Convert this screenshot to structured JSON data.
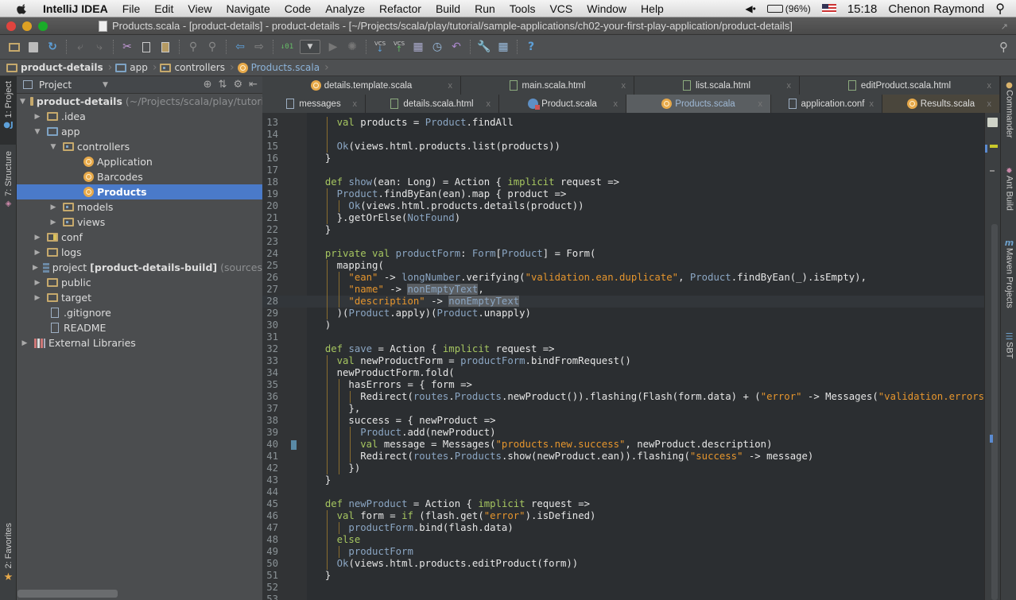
{
  "menubar": {
    "app_name": "IntelliJ IDEA",
    "items": [
      "File",
      "Edit",
      "View",
      "Navigate",
      "Code",
      "Analyze",
      "Refactor",
      "Build",
      "Run",
      "Tools",
      "VCS",
      "Window",
      "Help"
    ],
    "battery": "(96%)",
    "time": "15:18",
    "user": "Chenon Raymond"
  },
  "window": {
    "title": "Products.scala - [product-details] - product-details - [~/Projects/scala/play/tutorial/sample-applications/ch02-your-first-play-application/product-details]"
  },
  "toolbar": {
    "buttons": [
      "open-icon",
      "save-icon",
      "sync-icon",
      "undo-icon",
      "redo-icon",
      "cut-icon",
      "copy-icon",
      "paste-icon",
      "find-icon",
      "replace-icon",
      "back-icon",
      "forward-icon",
      "make-icon",
      "run-config-dropdown",
      "run-icon",
      "debug-icon",
      "vcs-update-icon",
      "vcs-commit-icon",
      "vcs-compare-icon",
      "vcs-history-icon",
      "vcs-revert-icon",
      "settings-icon",
      "project-structure-icon",
      "help-icon"
    ],
    "vcs_label": "VCS"
  },
  "breadcrumb": [
    {
      "label": "product-details",
      "icon": "project-folder-icon"
    },
    {
      "label": "app",
      "icon": "folder-icon"
    },
    {
      "label": "controllers",
      "icon": "package-icon"
    },
    {
      "label": "Products.scala",
      "icon": "scala-object-icon"
    }
  ],
  "left_strip": {
    "project_tab": "1: Project",
    "structure_tab": "7: Structure",
    "favorites_tab": "2: Favorites"
  },
  "project_panel": {
    "view_selector": "Project",
    "tree": [
      {
        "label": "product-details",
        "suffix": "(~/Projects/scala/play/tutori",
        "level": 0,
        "expanded": true,
        "icon": "project-folder-icon",
        "bold": true
      },
      {
        "label": ".idea",
        "level": 1,
        "expanded": false,
        "icon": "folder-icon"
      },
      {
        "label": "app",
        "level": 1,
        "expanded": true,
        "icon": "source-folder-icon"
      },
      {
        "label": "controllers",
        "level": 2,
        "expanded": true,
        "icon": "package-icon"
      },
      {
        "label": "Application",
        "level": 3,
        "icon": "scala-object-icon"
      },
      {
        "label": "Barcodes",
        "level": 3,
        "icon": "scala-object-icon"
      },
      {
        "label": "Products",
        "level": 3,
        "icon": "scala-object-icon",
        "selected": true
      },
      {
        "label": "models",
        "level": 2,
        "expanded": false,
        "icon": "package-icon"
      },
      {
        "label": "views",
        "level": 2,
        "expanded": false,
        "icon": "package-icon"
      },
      {
        "label": "conf",
        "level": 1,
        "expanded": false,
        "icon": "resource-folder-icon"
      },
      {
        "label": "logs",
        "level": 1,
        "expanded": false,
        "icon": "folder-icon"
      },
      {
        "label": "project",
        "bold_part": "[product-details-build]",
        "suffix": "(sources",
        "level": 1,
        "expanded": false,
        "icon": "module-icon"
      },
      {
        "label": "public",
        "level": 1,
        "expanded": false,
        "icon": "folder-icon"
      },
      {
        "label": "target",
        "level": 1,
        "expanded": false,
        "icon": "folder-icon"
      },
      {
        "label": ".gitignore",
        "level": 1,
        "icon": "file-icon"
      },
      {
        "label": "README",
        "level": 1,
        "icon": "file-icon"
      },
      {
        "label": "External Libraries",
        "level": 0,
        "expanded": false,
        "icon": "library-icon"
      }
    ]
  },
  "tabs_row1": [
    {
      "label": "details.template.scala",
      "icon": "scala-object-icon"
    },
    {
      "label": "main.scala.html",
      "icon": "html-file-icon"
    },
    {
      "label": "list.scala.html",
      "icon": "html-file-icon"
    },
    {
      "label": "editProduct.scala.html",
      "icon": "html-file-icon"
    }
  ],
  "tabs_row2": [
    {
      "label": "messages",
      "icon": "text-file-icon"
    },
    {
      "label": "details.scala.html",
      "icon": "html-file-icon"
    },
    {
      "label": "Product.scala",
      "icon": "scala-class-icon"
    },
    {
      "label": "Products.scala",
      "icon": "scala-object-icon",
      "active": true
    },
    {
      "label": "application.conf",
      "icon": "config-file-icon"
    },
    {
      "label": "Results.scala",
      "icon": "scala-object-icon"
    }
  ],
  "right_strip": {
    "items": [
      "Commander",
      "Ant Build",
      "Maven Projects",
      "SBT"
    ]
  },
  "editor": {
    "file": "Products.scala",
    "caret_line": 28,
    "bookmark_line": 40,
    "lines": [
      {
        "n": "13",
        "indent": 4,
        "tokens": [
          [
            "kw",
            "val"
          ],
          [
            "txt",
            " products = "
          ],
          [
            "ty",
            "Product"
          ],
          [
            "txt",
            ".findAll"
          ]
        ]
      },
      {
        "n": "14",
        "indent": 0,
        "tokens": []
      },
      {
        "n": "15",
        "indent": 4,
        "tokens": [
          [
            "ty",
            "Ok"
          ],
          [
            "txt",
            "(views.html.products.list(products))"
          ]
        ]
      },
      {
        "n": "16",
        "indent": 2,
        "tokens": [
          [
            "txt",
            "}"
          ]
        ]
      },
      {
        "n": "17",
        "indent": 0,
        "tokens": []
      },
      {
        "n": "18",
        "indent": 2,
        "tokens": [
          [
            "kw",
            "def"
          ],
          [
            "txt",
            " "
          ],
          [
            "id",
            "show"
          ],
          [
            "txt",
            "(ean: Long) = Action { "
          ],
          [
            "kw",
            "implicit"
          ],
          [
            "txt",
            " request =>"
          ]
        ]
      },
      {
        "n": "19",
        "indent": 4,
        "tokens": [
          [
            "ty",
            "Product"
          ],
          [
            "txt",
            ".findByEan(ean).map { product =>"
          ]
        ]
      },
      {
        "n": "20",
        "indent": 6,
        "tokens": [
          [
            "ty",
            "Ok"
          ],
          [
            "txt",
            "(views.html.products.details(product))"
          ]
        ]
      },
      {
        "n": "21",
        "indent": 4,
        "tokens": [
          [
            "txt",
            "}.getOrElse("
          ],
          [
            "ty",
            "NotFound"
          ],
          [
            "txt",
            ")"
          ]
        ]
      },
      {
        "n": "22",
        "indent": 2,
        "tokens": [
          [
            "txt",
            "}"
          ]
        ]
      },
      {
        "n": "23",
        "indent": 0,
        "tokens": []
      },
      {
        "n": "24",
        "indent": 2,
        "tokens": [
          [
            "kw",
            "private val"
          ],
          [
            "txt",
            " "
          ],
          [
            "id",
            "productForm"
          ],
          [
            "txt",
            ": "
          ],
          [
            "ty",
            "Form"
          ],
          [
            "txt",
            "["
          ],
          [
            "ty",
            "Product"
          ],
          [
            "txt",
            "] = Form("
          ]
        ]
      },
      {
        "n": "25",
        "indent": 4,
        "tokens": [
          [
            "txt",
            "mapping("
          ]
        ]
      },
      {
        "n": "26",
        "indent": 6,
        "tokens": [
          [
            "str",
            "\"ean\""
          ],
          [
            "txt",
            " -> "
          ],
          [
            "id",
            "longNumber"
          ],
          [
            "txt",
            ".verifying("
          ],
          [
            "str",
            "\"validation.ean.duplicate\""
          ],
          [
            "txt",
            ", "
          ],
          [
            "ty",
            "Product"
          ],
          [
            "txt",
            ".findByEan(_).isEmpty),"
          ]
        ]
      },
      {
        "n": "27",
        "indent": 6,
        "tokens": [
          [
            "str",
            "\"name\""
          ],
          [
            "txt",
            " -> "
          ],
          [
            "hl",
            "nonEmptyText"
          ],
          [
            "txt",
            ","
          ]
        ]
      },
      {
        "n": "28",
        "indent": 6,
        "tokens": [
          [
            "str",
            "\"description\""
          ],
          [
            "txt",
            " -> "
          ],
          [
            "hl",
            "nonEmptyText"
          ]
        ]
      },
      {
        "n": "29",
        "indent": 4,
        "tokens": [
          [
            "txt",
            ")("
          ],
          [
            "ty",
            "Product"
          ],
          [
            "txt",
            ".apply)("
          ],
          [
            "ty",
            "Product"
          ],
          [
            "txt",
            ".unapply)"
          ]
        ]
      },
      {
        "n": "30",
        "indent": 2,
        "tokens": [
          [
            "txt",
            ")"
          ]
        ]
      },
      {
        "n": "31",
        "indent": 0,
        "tokens": []
      },
      {
        "n": "32",
        "indent": 2,
        "tokens": [
          [
            "kw",
            "def"
          ],
          [
            "txt",
            " "
          ],
          [
            "id",
            "save"
          ],
          [
            "txt",
            " = Action { "
          ],
          [
            "kw",
            "implicit"
          ],
          [
            "txt",
            " request =>"
          ]
        ]
      },
      {
        "n": "33",
        "indent": 4,
        "tokens": [
          [
            "kw",
            "val"
          ],
          [
            "txt",
            " newProductForm = "
          ],
          [
            "id",
            "productForm"
          ],
          [
            "txt",
            ".bindFromRequest()"
          ]
        ]
      },
      {
        "n": "34",
        "indent": 4,
        "tokens": [
          [
            "txt",
            "newProductForm.fold("
          ]
        ]
      },
      {
        "n": "35",
        "indent": 6,
        "tokens": [
          [
            "txt",
            "hasErrors = { form =>"
          ]
        ]
      },
      {
        "n": "36",
        "indent": 8,
        "tokens": [
          [
            "txt",
            "Redirect("
          ],
          [
            "id",
            "routes"
          ],
          [
            "txt",
            "."
          ],
          [
            "ty",
            "Products"
          ],
          [
            "txt",
            ".newProduct()).flashing(Flash(form.data) + ("
          ],
          [
            "str",
            "\"error\""
          ],
          [
            "txt",
            " -> Messages("
          ],
          [
            "str",
            "\"validation.errors\""
          ],
          [
            "txt",
            ")))"
          ]
        ]
      },
      {
        "n": "37",
        "indent": 6,
        "tokens": [
          [
            "txt",
            "},"
          ]
        ]
      },
      {
        "n": "38",
        "indent": 6,
        "tokens": [
          [
            "txt",
            "success = { newProduct =>"
          ]
        ]
      },
      {
        "n": "39",
        "indent": 8,
        "tokens": [
          [
            "ty",
            "Product"
          ],
          [
            "txt",
            ".add(newProduct)"
          ]
        ]
      },
      {
        "n": "40",
        "indent": 8,
        "tokens": [
          [
            "kw",
            "val"
          ],
          [
            "txt",
            " message = Messages("
          ],
          [
            "str",
            "\"products.new.success\""
          ],
          [
            "txt",
            ", newProduct.description)"
          ]
        ]
      },
      {
        "n": "41",
        "indent": 8,
        "tokens": [
          [
            "txt",
            "Redirect("
          ],
          [
            "id",
            "routes"
          ],
          [
            "txt",
            "."
          ],
          [
            "ty",
            "Products"
          ],
          [
            "txt",
            ".show(newProduct.ean)).flashing("
          ],
          [
            "str",
            "\"success\""
          ],
          [
            "txt",
            " -> message)"
          ]
        ]
      },
      {
        "n": "42",
        "indent": 6,
        "tokens": [
          [
            "txt",
            "})"
          ]
        ]
      },
      {
        "n": "43",
        "indent": 2,
        "tokens": [
          [
            "txt",
            "}"
          ]
        ]
      },
      {
        "n": "44",
        "indent": 0,
        "tokens": []
      },
      {
        "n": "45",
        "indent": 2,
        "tokens": [
          [
            "kw",
            "def"
          ],
          [
            "txt",
            " "
          ],
          [
            "id",
            "newProduct"
          ],
          [
            "txt",
            " = Action { "
          ],
          [
            "kw",
            "implicit"
          ],
          [
            "txt",
            " request =>"
          ]
        ]
      },
      {
        "n": "46",
        "indent": 4,
        "tokens": [
          [
            "kw",
            "val"
          ],
          [
            "txt",
            " form = "
          ],
          [
            "kw",
            "if"
          ],
          [
            "txt",
            " (flash.get("
          ],
          [
            "str",
            "\"error\""
          ],
          [
            "txt",
            ").isDefined)"
          ]
        ]
      },
      {
        "n": "47",
        "indent": 6,
        "tokens": [
          [
            "id",
            "productForm"
          ],
          [
            "txt",
            ".bind(flash.data)"
          ]
        ]
      },
      {
        "n": "48",
        "indent": 4,
        "tokens": [
          [
            "kw",
            "else"
          ]
        ]
      },
      {
        "n": "49",
        "indent": 6,
        "tokens": [
          [
            "id",
            "productForm"
          ]
        ]
      },
      {
        "n": "50",
        "indent": 4,
        "tokens": [
          [
            "ty",
            "Ok"
          ],
          [
            "txt",
            "(views.html.products.editProduct(form))"
          ]
        ]
      },
      {
        "n": "51",
        "indent": 2,
        "tokens": [
          [
            "txt",
            "}"
          ]
        ]
      },
      {
        "n": "52",
        "indent": 0,
        "tokens": []
      },
      {
        "n": "53",
        "indent": 0,
        "tokens": []
      }
    ]
  },
  "colors": {
    "selection": "#4a7ac9",
    "keyword": "#a6c660",
    "string": "#e5952d",
    "identifier": "#8ba6c3",
    "editor_bg": "#2b2e31"
  }
}
